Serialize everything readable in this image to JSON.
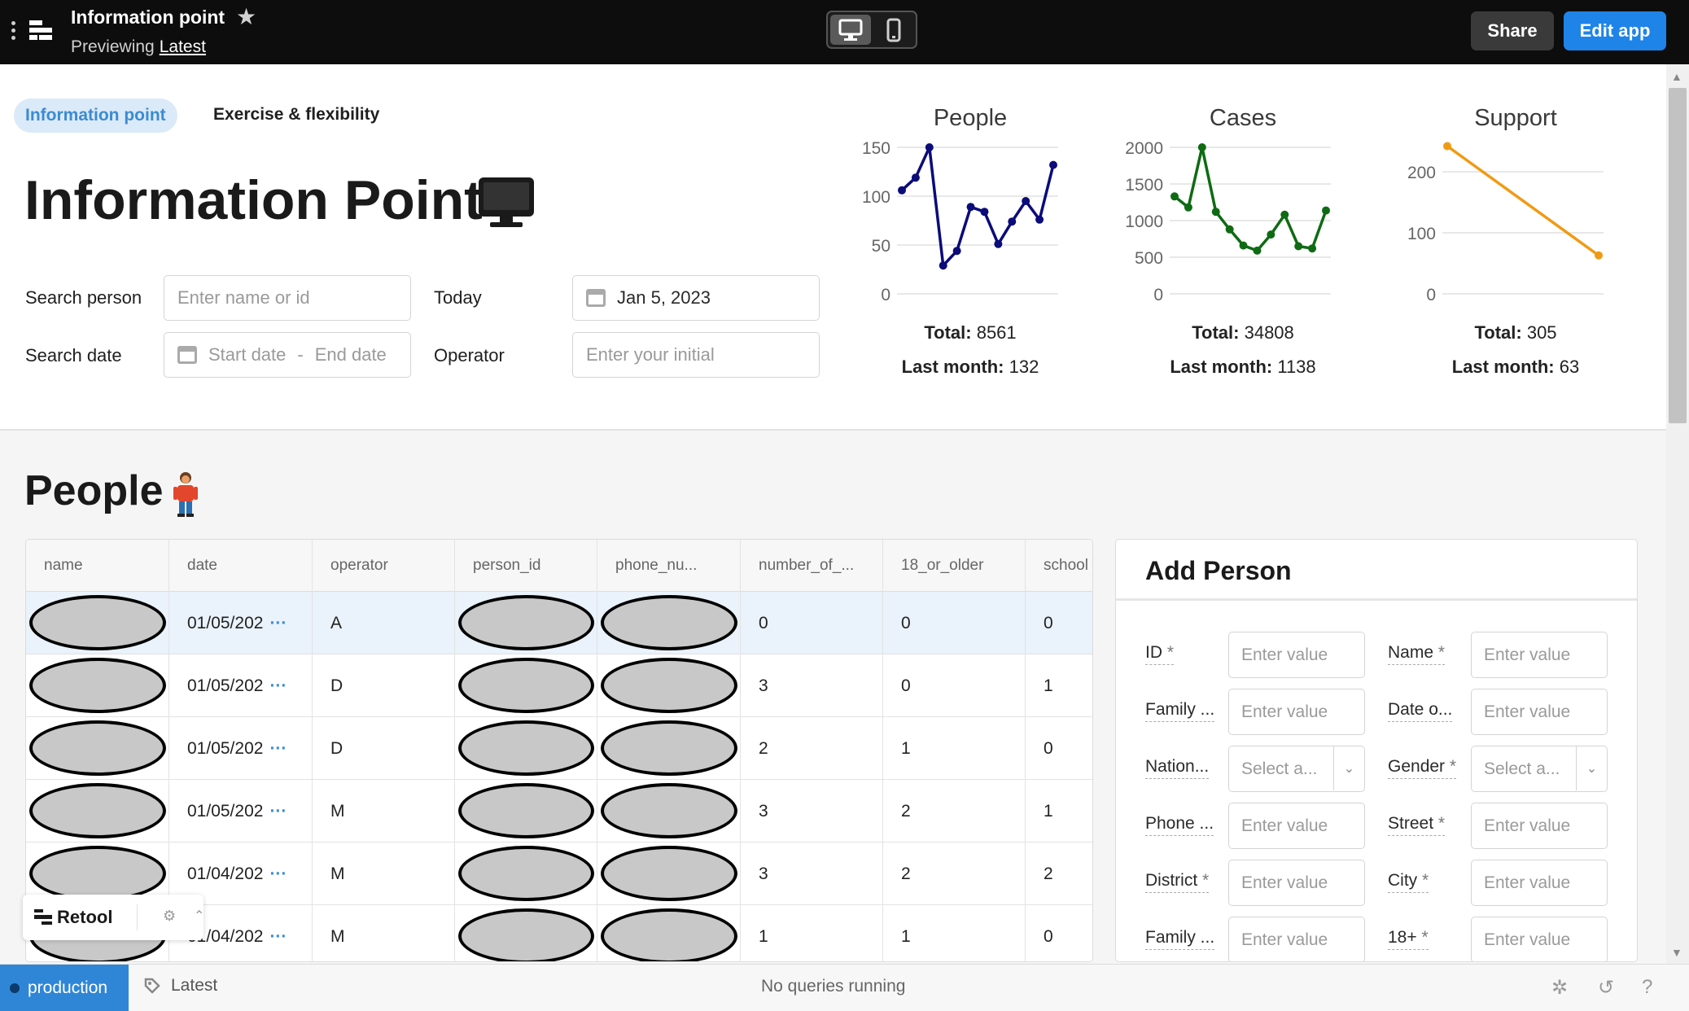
{
  "app": {
    "title": "Information point",
    "preview_prefix": "Previewing",
    "preview_version": "Latest",
    "share_label": "Share",
    "edit_label": "Edit app"
  },
  "tabs": [
    "Information point",
    "Exercise & flexibility"
  ],
  "page_title": "Information Point",
  "filters": {
    "search_person_label": "Search person",
    "search_person_placeholder": "Enter name or id",
    "search_date_label": "Search date",
    "start_date_placeholder": "Start date",
    "end_date_placeholder": "End date",
    "date_separator": "-",
    "today_label": "Today",
    "today_value": "Jan 5, 2023",
    "operator_label": "Operator",
    "operator_placeholder": "Enter your initial"
  },
  "charts_colors": {
    "people": "#0b0b7a",
    "cases": "#0e6b13",
    "support": "#f09a14"
  },
  "chart_data": [
    {
      "type": "line",
      "title": "People",
      "y": [
        106,
        119,
        150,
        29,
        44,
        89,
        84,
        51,
        74,
        95,
        76,
        132
      ],
      "ylim": [
        0,
        150
      ],
      "yticks": [
        0,
        50,
        100,
        150
      ],
      "grid": true,
      "total_label": "Total:",
      "total": "8561",
      "last_month_label": "Last month:",
      "last_month": "132"
    },
    {
      "type": "line",
      "title": "Cases",
      "y": [
        1330,
        1180,
        2000,
        1120,
        880,
        660,
        590,
        810,
        1080,
        650,
        620,
        1138
      ],
      "ylim": [
        0,
        2000
      ],
      "yticks": [
        0,
        500,
        1000,
        1500,
        2000
      ],
      "grid": true,
      "total_label": "Total:",
      "total": "34808",
      "last_month_label": "Last month:",
      "last_month": "1138"
    },
    {
      "type": "line",
      "title": "Support",
      "y": [
        242,
        63
      ],
      "ylim": [
        0,
        240
      ],
      "yticks": [
        0,
        100,
        200
      ],
      "grid": true,
      "total_label": "Total:",
      "total": "305",
      "last_month_label": "Last month:",
      "last_month": "63"
    }
  ],
  "people_section": {
    "title": "People",
    "columns": [
      "name",
      "date",
      "operator",
      "person_id",
      "phone_nu...",
      "number_of_...",
      "18_or_older",
      "school"
    ],
    "rows": [
      {
        "date": "01/05/202",
        "operator": "A",
        "number_of": "0",
        "older": "0",
        "school": "0"
      },
      {
        "date": "01/05/202",
        "operator": "D",
        "number_of": "3",
        "older": "0",
        "school": "1"
      },
      {
        "date": "01/05/202",
        "operator": "D",
        "number_of": "2",
        "older": "1",
        "school": "0"
      },
      {
        "date": "01/05/202",
        "operator": "M",
        "number_of": "3",
        "older": "2",
        "school": "1"
      },
      {
        "date": "01/04/202",
        "operator": "M",
        "number_of": "3",
        "older": "2",
        "school": "2"
      },
      {
        "date": "01/04/202",
        "operator": "M",
        "number_of": "1",
        "older": "1",
        "school": "0"
      }
    ],
    "more_glyph": "···"
  },
  "add_person": {
    "title": "Add Person",
    "placeholder": "Enter value",
    "select_placeholder": "Select a...",
    "required_mark": "*",
    "fields_left": [
      "ID",
      "Family ...",
      "Nation...",
      "Phone ...",
      "District",
      "Family ..."
    ],
    "fields_right": [
      "Name",
      "Date o...",
      "Gender",
      "Street",
      "City",
      "18+"
    ]
  },
  "retool_badge": {
    "label": "Retool"
  },
  "status": {
    "environment": "production",
    "release": "Latest",
    "queries": "No queries running"
  }
}
